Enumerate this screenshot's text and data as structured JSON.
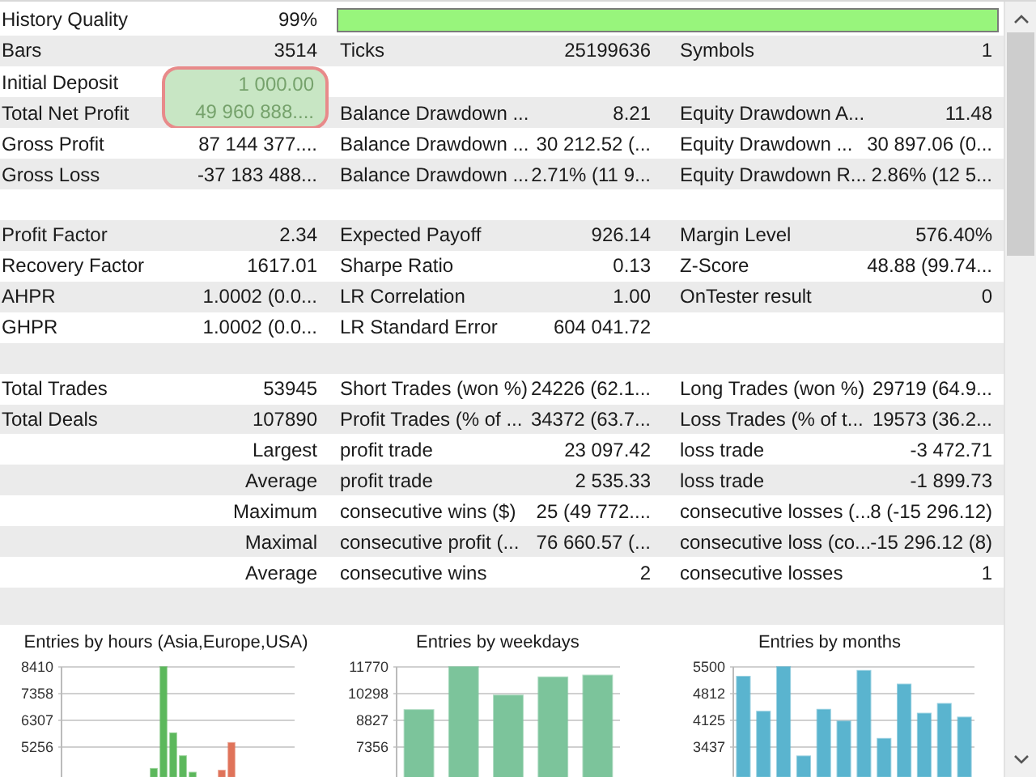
{
  "rows": [
    {
      "kind": "quality",
      "label": "History Quality",
      "value": "99%",
      "level": 0.99,
      "highlighted": false
    },
    {
      "kind": "stats",
      "label": "Bars",
      "value": "3514",
      "label_2": "Ticks",
      "value_2": "25199636",
      "label_3": "Symbols",
      "value_3": "1",
      "highlighted": false
    },
    {
      "kind": "stats",
      "label": "Initial Deposit",
      "value": "1 000.00",
      "highlighted": true
    },
    {
      "kind": "stats",
      "label": "Total Net Profit",
      "value": "49 960 888....",
      "label_2": "Balance Drawdown ...",
      "value_2": "8.21",
      "label_3": "Equity Drawdown A...",
      "value_3": "11.48",
      "highlighted": true
    },
    {
      "kind": "stats",
      "label": "Gross Profit",
      "value": "87 144 377....",
      "label_2": "Balance Drawdown ...",
      "value_2": "30 212.52 (...",
      "label_3": "Equity Drawdown ...",
      "value_3": "30 897.06 (0...",
      "highlighted": false
    },
    {
      "kind": "stats",
      "label": "Gross Loss",
      "value": "-37 183 488...",
      "label_2": "Balance Drawdown ...",
      "value_2": "2.71% (11 9...",
      "label_3": "Equity Drawdown R...",
      "value_3": "2.86% (12 5...",
      "highlighted": false
    },
    {
      "kind": "blank",
      "highlighted": false
    },
    {
      "kind": "stats",
      "label": "Profit Factor",
      "value": "2.34",
      "label_2": "Expected Payoff",
      "value_2": "926.14",
      "label_3": "Margin Level",
      "value_3": "576.40%",
      "highlighted": false
    },
    {
      "kind": "stats",
      "label": "Recovery Factor",
      "value": "1617.01",
      "label_2": "Sharpe Ratio",
      "value_2": "0.13",
      "label_3": "Z-Score",
      "value_3": "48.88 (99.74...",
      "highlighted": false
    },
    {
      "kind": "stats",
      "label": "AHPR",
      "value": "1.0002 (0.0...",
      "label_2": "LR Correlation",
      "value_2": "1.00",
      "label_3": "OnTester result",
      "value_3": "0",
      "highlighted": false
    },
    {
      "kind": "stats",
      "label": "GHPR",
      "value": "1.0002 (0.0...",
      "label_2": "LR Standard Error",
      "value_2": "604 041.72",
      "highlighted": false
    },
    {
      "kind": "blank",
      "highlighted": false
    },
    {
      "kind": "stats",
      "label": "Total Trades",
      "value": "53945",
      "label_2": "Short Trades (won %)",
      "value_2": "24226 (62.1...",
      "label_3": "Long Trades (won %)",
      "value_3": "29719 (64.9...",
      "highlighted": false
    },
    {
      "kind": "stats",
      "label": "Total Deals",
      "value": "107890",
      "label_2": "Profit Trades (% of ...",
      "value_2": "34372 (63.7...",
      "label_3": "Loss Trades (% of t...",
      "value_3": "19573 (36.2...",
      "highlighted": false
    },
    {
      "kind": "stats",
      "value": "Largest",
      "label_2": "profit trade",
      "value_2": "23 097.42",
      "label_3": "loss trade",
      "value_3": "-3 472.71",
      "highlighted": false
    },
    {
      "kind": "stats",
      "value": "Average",
      "label_2": "profit trade",
      "value_2": "2 535.33",
      "label_3": "loss trade",
      "value_3": "-1 899.73",
      "highlighted": false
    },
    {
      "kind": "stats",
      "value": "Maximum",
      "label_2": "consecutive wins ($)",
      "value_2": "25 (49 772....",
      "label_3": "consecutive losses (...",
      "value_3": "8 (-15 296.12)",
      "highlighted": false
    },
    {
      "kind": "stats",
      "value": "Maximal",
      "label_2": "consecutive profit (...",
      "value_2": "76 660.57 (...",
      "label_3": "consecutive loss (co...",
      "value_3": "-15 296.12 (8)",
      "highlighted": false
    },
    {
      "kind": "stats",
      "value": "Average",
      "label_2": "consecutive wins",
      "value_2": "2",
      "label_3": "consecutive losses",
      "value_3": "1",
      "highlighted": false
    },
    {
      "kind": "blank",
      "highlighted": false
    }
  ],
  "charts": [
    {
      "title": "Entries by hours (Asia,Europe,USA)",
      "chart_data": {
        "type": "bar",
        "grid": true,
        "yticks": [
          5256,
          6307,
          7358,
          8410
        ],
        "ylim": [
          4080,
          8410
        ],
        "series": [
          {
            "color": "#5cb85c",
            "values": [
              null,
              null,
              null,
              null,
              null,
              null,
              null,
              null,
              null,
              4400,
              8410,
              5800,
              4900,
              4250,
              null,
              null,
              null,
              null,
              null,
              null,
              null,
              null,
              null,
              null
            ]
          },
          {
            "color": "#e0735a",
            "values": [
              null,
              null,
              null,
              null,
              null,
              null,
              null,
              null,
              null,
              null,
              null,
              null,
              null,
              null,
              null,
              null,
              4330,
              5420,
              null,
              null,
              null,
              null,
              null,
              null
            ]
          }
        ]
      }
    },
    {
      "title": "Entries by weekdays",
      "chart_data": {
        "type": "bar",
        "grid": true,
        "yticks": [
          7356,
          8827,
          10298,
          11770
        ],
        "ylim": [
          5700,
          11770
        ],
        "series": [
          {
            "color": "#7cc49b",
            "values": [
              9400,
              11770,
              10200,
              11200,
              11300
            ]
          }
        ]
      }
    },
    {
      "title": "Entries by months",
      "chart_data": {
        "type": "bar",
        "grid": true,
        "yticks": [
          3437,
          4125,
          4812,
          5500
        ],
        "ylim": [
          2670,
          5500
        ],
        "series": [
          {
            "color": "#5ab4cf",
            "values": [
              5250,
              4350,
              5500,
              3200,
              4400,
              4100,
              5400,
              3650,
              5050,
              4300,
              4550,
              4200
            ]
          }
        ]
      }
    }
  ]
}
